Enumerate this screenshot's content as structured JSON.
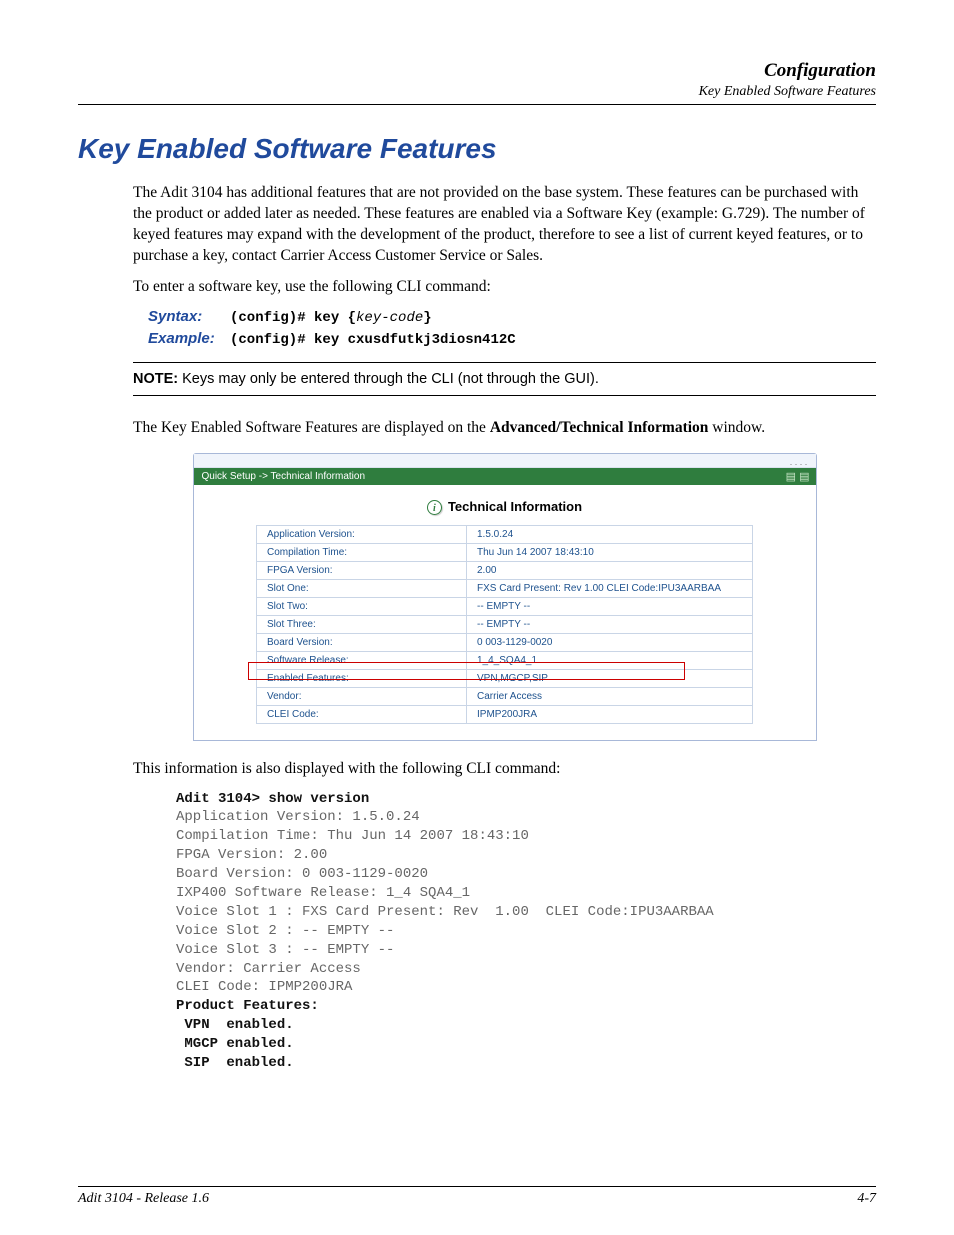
{
  "header": {
    "title": "Configuration",
    "subtitle": "Key Enabled Software Features"
  },
  "main_heading": "Key Enabled Software Features",
  "intro_p1": "The Adit 3104 has additional features that are not provided on the base system. These features can be purchased with the product or added later as needed. These features are enabled via a Software Key (example: G.729). The number of keyed features may expand with the development of the product, therefore to see a list of current keyed features, or to purchase a key, contact Carrier Access Customer Service or Sales.",
  "intro_p2": "To enter a software key, use the following CLI command:",
  "syntax": {
    "label": "Syntax:",
    "prefix": "(config)# key {",
    "arg": "key-code",
    "suffix": "}"
  },
  "example": {
    "label": "Example:",
    "text": "(config)# key cxusdfutkj3diosn412C"
  },
  "note": {
    "label": "NOTE:",
    "text": "  Keys may only be entered through the CLI (not through the GUI)."
  },
  "disp_text": {
    "pre": "The Key Enabled Software Features are displayed on the ",
    "bold": "Advanced/Technical Information",
    "post": " window."
  },
  "screenshot": {
    "breadcrumb": "Quick Setup -> Technical Information",
    "panel_title": "Technical Information",
    "rows": [
      {
        "label": "Application Version:",
        "value": "1.5.0.24"
      },
      {
        "label": "Compilation Time:",
        "value": "Thu Jun 14 2007 18:43:10"
      },
      {
        "label": "FPGA Version:",
        "value": "2.00"
      },
      {
        "label": "Slot One:",
        "value": "FXS Card Present: Rev 1.00 CLEI Code:IPU3AARBAA"
      },
      {
        "label": "Slot Two:",
        "value": "-- EMPTY --"
      },
      {
        "label": "Slot Three:",
        "value": "-- EMPTY --"
      },
      {
        "label": "Board Version:",
        "value": "0 003-1129-0020"
      },
      {
        "label": "Software Release:",
        "value": "1_4_SQA4_1"
      },
      {
        "label": "Enabled Features:",
        "value": "VPN,MGCP,SIP"
      },
      {
        "label": "Vendor:",
        "value": "Carrier Access"
      },
      {
        "label": "CLEI Code:",
        "value": "IPMP200JRA"
      }
    ]
  },
  "cli_disp_text": "This information is also displayed with the following CLI command:",
  "cli_output": {
    "prompt_line": "Adit 3104> show version",
    "lines": [
      "Application Version: 1.5.0.24",
      "Compilation Time: Thu Jun 14 2007 18:43:10",
      "FPGA Version: 2.00",
      "Board Version: 0 003-1129-0020",
      "IXP400 Software Release: 1_4 SQA4_1",
      "Voice Slot 1 : FXS Card Present: Rev  1.00  CLEI Code:IPU3AARBAA",
      "Voice Slot 2 : -- EMPTY --",
      "Voice Slot 3 : -- EMPTY --",
      "Vendor: Carrier Access",
      "CLEI Code: IPMP200JRA"
    ],
    "features_heading": "Product Features:",
    "features": [
      " VPN  enabled.",
      " MGCP enabled.",
      " SIP  enabled."
    ]
  },
  "footer": {
    "left": "Adit 3104 - Release 1.6",
    "right": "4-7"
  }
}
